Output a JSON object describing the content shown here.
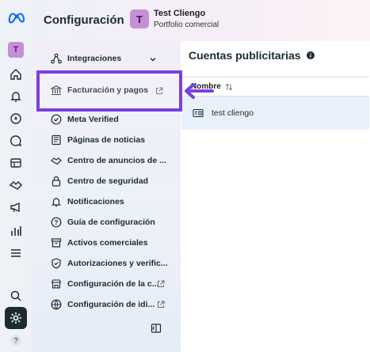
{
  "app": {
    "title": "Configuración"
  },
  "business": {
    "initial": "T",
    "name": "Test Cliengo",
    "portfolio": "Portfolio comercial"
  },
  "rail": {
    "account_initial": "T"
  },
  "menu": {
    "integrations": "Integraciones",
    "items": [
      {
        "label": "Facturación y pagos",
        "icon": "bank-icon",
        "external": true
      },
      {
        "label": "Meta Verified",
        "icon": "verified-badge-icon",
        "external": false
      },
      {
        "label": "Páginas de noticias",
        "icon": "newspaper-icon",
        "external": false
      },
      {
        "label": "Centro de anuncios de ...",
        "icon": "handshake-icon",
        "external": false
      },
      {
        "label": "Centro de seguridad",
        "icon": "lock-icon",
        "external": false
      },
      {
        "label": "Notificaciones",
        "icon": "bell-icon",
        "external": false
      },
      {
        "label": "Guía de configuración",
        "icon": "question-icon",
        "external": false
      },
      {
        "label": "Activos comerciales",
        "icon": "archive-box-icon",
        "external": false
      },
      {
        "label": "Autorizaciones y verific...",
        "icon": "shield-check-icon",
        "external": false
      },
      {
        "label": "Configuración de la c...",
        "icon": "store-icon",
        "external": true
      },
      {
        "label": "Configuración de idi...",
        "icon": "globe-icon",
        "external": true
      }
    ]
  },
  "main": {
    "title": "Cuentas publicitarias",
    "column_header": "Nombre",
    "rows": [
      {
        "name": "test cliengo"
      }
    ]
  },
  "colors": {
    "highlight": "#7a3fe0",
    "rail_active": "#1c2b33",
    "row_selected": "#e7f0fb"
  }
}
